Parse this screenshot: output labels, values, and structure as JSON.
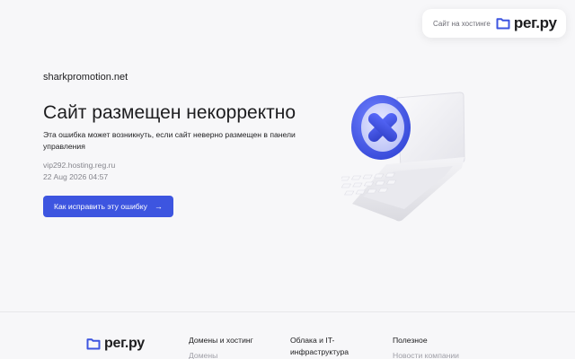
{
  "header": {
    "hosting_label": "Сайт на хостинге",
    "brand": "рег.ру"
  },
  "main": {
    "domain": "sharkpromotion.net",
    "title": "Сайт размещен некорректно",
    "description": "Эта ошибка может возникнуть, если сайт неверно размещен в панели управления",
    "server": "vip292.hosting.reg.ru",
    "timestamp": "22 Aug 2026 04:57",
    "fix_button_label": "Как исправить эту ошибку",
    "fix_button_arrow": "→"
  },
  "illustration": {
    "icon": "laptop-with-error-x-icon"
  },
  "footer": {
    "brand": "рег.ру",
    "columns": [
      {
        "heading": "Домены и хостинг",
        "link": "Домены"
      },
      {
        "heading": "Облака и IT-инфраструктура",
        "link": ""
      },
      {
        "heading": "Полезное",
        "link": "Новости компании"
      }
    ]
  },
  "colors": {
    "accent": "#3d55e0",
    "background": "#f7f7f9",
    "text": "#1d1d1f",
    "muted": "#86868d"
  }
}
